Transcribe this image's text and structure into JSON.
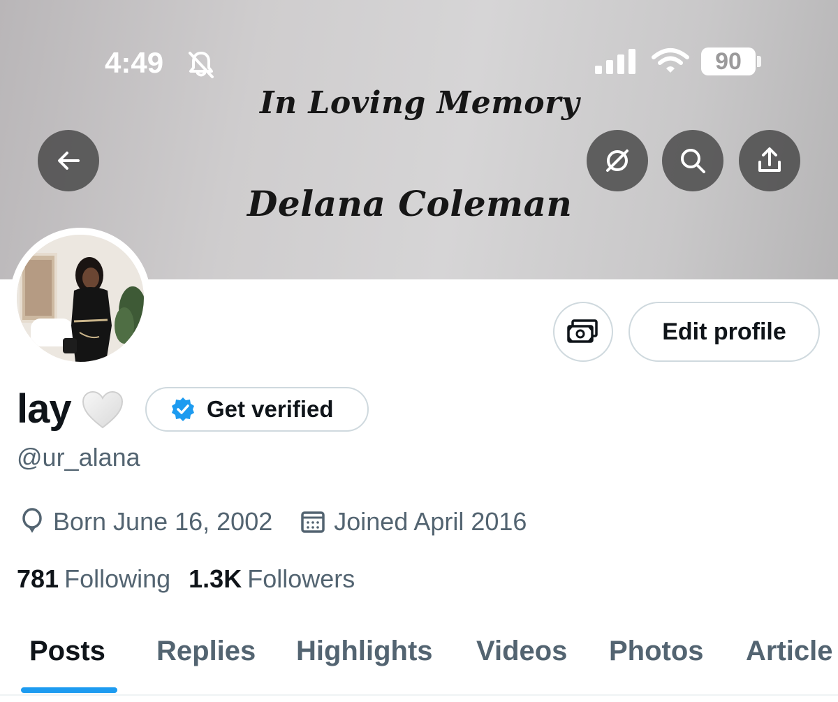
{
  "status_bar": {
    "time": "4:49",
    "battery": "90"
  },
  "banner": {
    "line1": "In Loving Memory",
    "line2": "Delana Coleman"
  },
  "header_icons": [
    "back-arrow-icon",
    "grok-icon",
    "search-icon",
    "share-icon"
  ],
  "profile": {
    "display_name": "lay",
    "emoji": "white-heart",
    "handle": "@ur_alana",
    "get_verified_label": "Get verified",
    "edit_profile_label": "Edit profile",
    "born": "Born June 16, 2002",
    "joined": "Joined April 2016",
    "following_count": "781",
    "following_label": "Following",
    "followers_count": "1.3K",
    "followers_label": "Followers"
  },
  "tabs": [
    {
      "label": "Posts",
      "active": true
    },
    {
      "label": "Replies",
      "active": false
    },
    {
      "label": "Highlights",
      "active": false
    },
    {
      "label": "Videos",
      "active": false
    },
    {
      "label": "Photos",
      "active": false
    },
    {
      "label": "Article",
      "active": false
    }
  ],
  "colors": {
    "accent": "#1d9bf0",
    "text_primary": "#0f1419",
    "text_secondary": "#536471",
    "border": "#cfd9de"
  }
}
